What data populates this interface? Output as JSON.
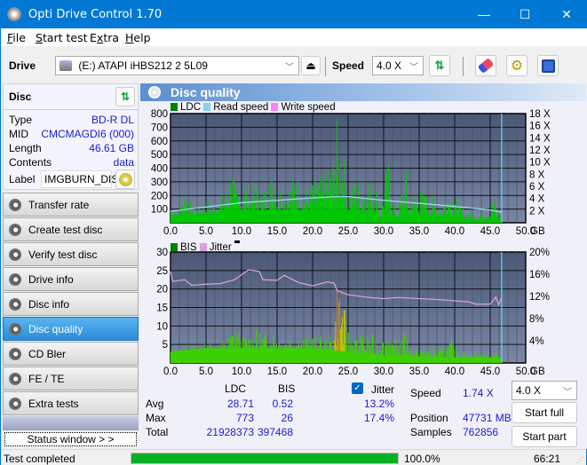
{
  "window": {
    "title": "Opti Drive Control 1.70",
    "min": "—",
    "max": "☐",
    "close": "✕"
  },
  "menu": {
    "file": "File",
    "start_test": "Start test",
    "extra": "Extra",
    "help": "Help"
  },
  "toolbar": {
    "drive_label": "Drive",
    "drive_value": "(E:)  ATAPI iHBS212  2 5L09",
    "speed_label": "Speed",
    "speed_value": "4.0 X"
  },
  "disc": {
    "header": "Disc",
    "rows": [
      {
        "key": "Type",
        "value": "BD-R DL"
      },
      {
        "key": "MID",
        "value": "CMCMAGDI6 (000)"
      },
      {
        "key": "Length",
        "value": "46.61 GB"
      },
      {
        "key": "Contents",
        "value": "data"
      }
    ],
    "label_key": "Label",
    "label_value": "IMGBURN_DIS"
  },
  "nav": [
    {
      "label": "Transfer rate",
      "active": false
    },
    {
      "label": "Create test disc",
      "active": false
    },
    {
      "label": "Verify test disc",
      "active": false
    },
    {
      "label": "Drive info",
      "active": false
    },
    {
      "label": "Disc info",
      "active": false
    },
    {
      "label": "Disc quality",
      "active": true
    },
    {
      "label": "CD Bler",
      "active": false
    },
    {
      "label": "FE / TE",
      "active": false
    },
    {
      "label": "Extra tests",
      "active": false
    }
  ],
  "status_window_button": "Status window > >",
  "panel_title": "Disc quality",
  "chart_data": [
    {
      "type": "bar",
      "title": "LDC",
      "legend": [
        {
          "name": "LDC",
          "color": "#008000"
        },
        {
          "name": "Read speed",
          "color": "#87cefa"
        },
        {
          "name": "Write speed",
          "color": "#ff80ff"
        }
      ],
      "xlabel": "GB",
      "xlim": [
        0,
        50
      ],
      "x_ticks": [
        "0.0",
        "5.0",
        "10.0",
        "15.0",
        "20.0",
        "25.0",
        "30.0",
        "35.0",
        "40.0",
        "45.0",
        "50.0"
      ],
      "ylim": [
        0,
        800
      ],
      "y_ticks": [
        "100",
        "200",
        "300",
        "400",
        "500",
        "600",
        "700",
        "800"
      ],
      "y2lim": [
        0,
        18
      ],
      "y2_ticks": [
        "2 X",
        "4 X",
        "6 X",
        "8 X",
        "10 X",
        "12 X",
        "14 X",
        "16 X",
        "18 X"
      ],
      "end_marker_gb": 46.61,
      "ldc_envelope": [
        [
          0,
          180
        ],
        [
          1,
          90
        ],
        [
          2,
          300
        ],
        [
          3,
          110
        ],
        [
          4,
          130
        ],
        [
          5,
          200
        ],
        [
          6,
          160
        ],
        [
          7,
          210
        ],
        [
          8,
          270
        ],
        [
          8.7,
          510
        ],
        [
          9,
          250
        ],
        [
          10,
          280
        ],
        [
          11,
          300
        ],
        [
          12,
          310
        ],
        [
          13,
          260
        ],
        [
          14,
          330
        ],
        [
          14.5,
          510
        ],
        [
          15,
          290
        ],
        [
          16,
          320
        ],
        [
          17,
          300
        ],
        [
          17.5,
          430
        ],
        [
          18,
          330
        ],
        [
          19,
          260
        ],
        [
          20,
          310
        ],
        [
          21,
          360
        ],
        [
          22,
          380
        ],
        [
          22.8,
          470
        ],
        [
          23.4,
          770
        ],
        [
          23.8,
          610
        ],
        [
          24.2,
          560
        ],
        [
          24.8,
          400
        ],
        [
          25,
          280
        ],
        [
          26,
          330
        ],
        [
          27,
          340
        ],
        [
          28,
          330
        ],
        [
          29,
          300
        ],
        [
          29.5,
          90
        ],
        [
          30,
          300
        ],
        [
          30.7,
          470
        ],
        [
          31,
          200
        ],
        [
          32,
          120
        ],
        [
          33,
          460
        ],
        [
          33.5,
          150
        ],
        [
          34,
          240
        ],
        [
          35,
          250
        ],
        [
          36,
          220
        ],
        [
          37,
          200
        ],
        [
          38,
          150
        ],
        [
          39,
          260
        ],
        [
          40,
          200
        ],
        [
          41,
          120
        ],
        [
          42,
          90
        ],
        [
          43,
          80
        ],
        [
          44,
          100
        ],
        [
          45,
          110
        ],
        [
          45.5,
          230
        ],
        [
          46,
          80
        ],
        [
          46.61,
          60
        ]
      ],
      "read_speed": [
        [
          0,
          1.9
        ],
        [
          5,
          2.6
        ],
        [
          10,
          3.3
        ],
        [
          15,
          3.7
        ],
        [
          20,
          4.1
        ],
        [
          23.5,
          4.3
        ],
        [
          25,
          4.3
        ],
        [
          30,
          3.7
        ],
        [
          35,
          3.2
        ],
        [
          40,
          2.7
        ],
        [
          45,
          2.1
        ],
        [
          46.61,
          1.74
        ]
      ]
    },
    {
      "type": "bar",
      "title": "BIS",
      "legend": [
        {
          "name": "BIS",
          "color": "#008000"
        },
        {
          "name": "Jitter",
          "color": "#d8a0d8"
        }
      ],
      "xlabel": "GB",
      "xlim": [
        0,
        50
      ],
      "x_ticks": [
        "0.0",
        "5.0",
        "10.0",
        "15.0",
        "20.0",
        "25.0",
        "30.0",
        "35.0",
        "40.0",
        "45.0",
        "50.0"
      ],
      "ylim": [
        0,
        30
      ],
      "y_ticks": [
        "5",
        "10",
        "15",
        "20",
        "25",
        "30"
      ],
      "y2lim": [
        0,
        20
      ],
      "y2_ticks": [
        "4%",
        "8%",
        "12%",
        "16%",
        "20%"
      ],
      "end_marker_gb": 46.61,
      "bis_envelope": [
        [
          0,
          4
        ],
        [
          2,
          5
        ],
        [
          4,
          5
        ],
        [
          6,
          6
        ],
        [
          8,
          7
        ],
        [
          8.8,
          11
        ],
        [
          10,
          8
        ],
        [
          12,
          9
        ],
        [
          14,
          9
        ],
        [
          14.5,
          10
        ],
        [
          16,
          8
        ],
        [
          17.5,
          9
        ],
        [
          18,
          8
        ],
        [
          20,
          8
        ],
        [
          22,
          7
        ],
        [
          23,
          10
        ],
        [
          23.5,
          26
        ],
        [
          24,
          20
        ],
        [
          24.5,
          14
        ],
        [
          25,
          9
        ],
        [
          26,
          8
        ],
        [
          28,
          8
        ],
        [
          30,
          7
        ],
        [
          30.5,
          11
        ],
        [
          31,
          5
        ],
        [
          33,
          9
        ],
        [
          34,
          4
        ],
        [
          36,
          5
        ],
        [
          38,
          4
        ],
        [
          39.5,
          7
        ],
        [
          40,
          4
        ],
        [
          42,
          3
        ],
        [
          44,
          3
        ],
        [
          45.5,
          3
        ],
        [
          46.61,
          2
        ]
      ],
      "jitter": [
        [
          0,
          16.5
        ],
        [
          0.3,
          14.7
        ],
        [
          2,
          15
        ],
        [
          3,
          14
        ],
        [
          5,
          14.2
        ],
        [
          7,
          14.3
        ],
        [
          9,
          15
        ],
        [
          11,
          16.8
        ],
        [
          12.5,
          16.5
        ],
        [
          13,
          15
        ],
        [
          15,
          14.9
        ],
        [
          16,
          15.8
        ],
        [
          18,
          14.5
        ],
        [
          20,
          13.9
        ],
        [
          22,
          14.6
        ],
        [
          23,
          14.4
        ],
        [
          23.5,
          13
        ],
        [
          25,
          12.3
        ],
        [
          28,
          11.8
        ],
        [
          30,
          11.6
        ],
        [
          32,
          11.8
        ],
        [
          35,
          11.6
        ],
        [
          38,
          11.4
        ],
        [
          40,
          11.2
        ],
        [
          42,
          11
        ],
        [
          43,
          10.6
        ],
        [
          45,
          10.6
        ],
        [
          45.8,
          11.9
        ],
        [
          46.2,
          10.5
        ],
        [
          46.61,
          11.8
        ]
      ]
    }
  ],
  "stats": {
    "col_ldc": "LDC",
    "col_bis": "BIS",
    "jitter_label": "Jitter",
    "jitter_checked": true,
    "rows": [
      {
        "label": "Avg",
        "ldc": "28.71",
        "bis": "0.52",
        "jitter": "13.2%"
      },
      {
        "label": "Max",
        "ldc": "773",
        "bis": "26",
        "jitter": "17.4%"
      },
      {
        "label": "Total",
        "ldc": "21928373",
        "bis": "397468",
        "jitter": ""
      }
    ],
    "speed_label": "Speed",
    "speed_value": "1.74 X",
    "position_label": "Position",
    "position_value": "47731 MB",
    "samples_label": "Samples",
    "samples_value": "762856",
    "speed_select": "4.0 X",
    "start_full": "Start full",
    "start_part": "Start part"
  },
  "status": {
    "text": "Test completed",
    "progress_percent": 100,
    "progress_label": "100.0%",
    "elapsed": "66:21"
  },
  "colors": {
    "accent": "#0078d4",
    "progress": "#06b025",
    "value_blue": "#1a1ad0"
  }
}
